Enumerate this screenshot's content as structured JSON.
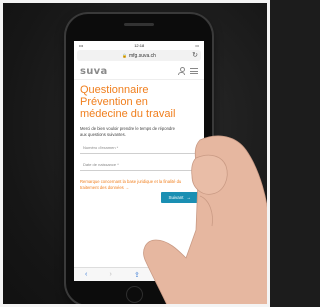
{
  "statusbar": {
    "time": "12:18"
  },
  "browser": {
    "url": "mfg.suva.ch"
  },
  "site": {
    "logo": "suva"
  },
  "page": {
    "title": "Questionnaire Prévention en médecine du travail",
    "intro": "Merci de bien vouloir prendre le temps de répondre aux questions suivantes.",
    "fields": {
      "exam_number_label": "Numéro d'examen *",
      "birth_date_label": "Date de naissance *"
    },
    "notice": "Remarque concernant la base juridique et la finalité du traitement des données →",
    "submit_label": "Suivant"
  },
  "icons": {
    "lock": "lock-icon",
    "reload": "reload-icon",
    "user": "user-icon",
    "menu": "menu-icon",
    "back": "back-icon",
    "share": "share-icon",
    "bookmarks": "bookmarks-icon",
    "tabs": "tabs-icon"
  },
  "colors": {
    "accent": "#f07f1e",
    "button": "#1a8fb3"
  }
}
